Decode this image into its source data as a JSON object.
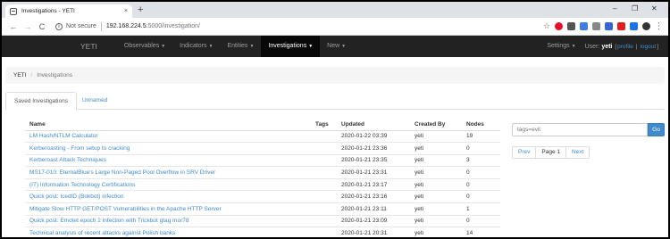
{
  "browser": {
    "tab_title": "Investigations - YETI",
    "tab_close": "×",
    "new_tab": "+",
    "window_controls": [
      "–",
      "❐",
      "✕"
    ],
    "nav_back": "←",
    "nav_forward": "→",
    "nav_reload": "C",
    "info_icon": "i",
    "security_text": "Not secure",
    "url_host": "192.168.224.5",
    "url_path": ":5000/investigation/",
    "bookmark_star": "☆",
    "menu": "⋮",
    "extension_colors": [
      "#e8102a",
      "#555555",
      "#3d7ee0",
      "#888888",
      "#3367d6",
      "#e02020",
      "#1a73e8",
      "#333333"
    ]
  },
  "navbar": {
    "brand": "YETI",
    "items": [
      {
        "label": "Observables",
        "caret": "▼"
      },
      {
        "label": "Indicators",
        "caret": "▼"
      },
      {
        "label": "Entities",
        "caret": "▼"
      },
      {
        "label": "Investigations",
        "caret": "▼"
      },
      {
        "label": "New",
        "caret": "▼"
      }
    ],
    "settings": "Settings",
    "settings_caret": "▼",
    "user_prefix": "User:",
    "user_name": "yeti",
    "profile_link": "profile",
    "logout_link": "logout",
    "pipe": "|",
    "paren_open": "[",
    "paren_close": "]"
  },
  "breadcrumb": {
    "root": "YETI",
    "separator": "/",
    "current": "Investigations"
  },
  "tabs": [
    {
      "label": "Saved Investigations"
    },
    {
      "label": "Unnamed"
    }
  ],
  "table": {
    "headers": [
      "Name",
      "Tags",
      "Updated",
      "Created By",
      "Nodes"
    ],
    "rows": [
      [
        "LM Hash/NTLM Calculator",
        "",
        "2020-01-22 03:39",
        "yeti",
        "19"
      ],
      [
        "Kerberoasting - From setup to cracking",
        "",
        "2020-01-21 23:36",
        "yeti",
        "0"
      ],
      [
        "Kerberoast Attack Techniques",
        "",
        "2020-01-21 23:35",
        "yeti",
        "3"
      ],
      [
        "MS17-010: EternalBlue's Large Non-Paged Pool Overflow in SRV Driver",
        "",
        "2020-01-21 23:31",
        "yeti",
        "0"
      ],
      [
        "(IT) Information Technology Certifications",
        "",
        "2020-01-21 23:17",
        "yeti",
        "0"
      ],
      [
        "Quick post: IcedID (Bokbot) infection",
        "",
        "2020-01-21 23:16",
        "yeti",
        "0"
      ],
      [
        "Mitigate Slow HTTP GET/POST Vulnerabilities in the Apache HTTP Server",
        "",
        "2020-01-21 23:11",
        "yeti",
        "1"
      ],
      [
        "Quick post: Emotet epoch 2 infection with Trickbot gtag mor78",
        "",
        "2020-01-21 23:09",
        "yeti",
        "0"
      ],
      [
        "Technical analysis of recent attacks against Polish banks",
        "",
        "2020-01-21 20:31",
        "yeti",
        "14"
      ]
    ]
  },
  "search": {
    "placeholder": "tags=evil",
    "button": "Go"
  },
  "pager": {
    "prev": "Prev",
    "current": "Page 1",
    "next": "Next"
  }
}
